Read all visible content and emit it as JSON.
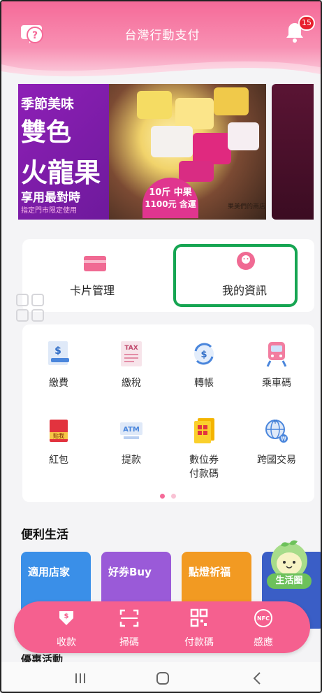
{
  "header": {
    "title": "台灣行動支付",
    "notification_count": "15"
  },
  "banner": {
    "headline_1": "季節美味",
    "headline_2": "雙色",
    "headline_3": "火龍果",
    "headline_4": "享用最對時",
    "sub": "指定門市限定使用",
    "price_1": "10斤 中果",
    "price_2": "1100元 含運",
    "shop": "果美們的商店"
  },
  "quick": {
    "card_label": "卡片管理",
    "info_label": "我的資訊"
  },
  "services": [
    {
      "label": "繳費",
      "icon": "bill-icon"
    },
    {
      "label": "繳稅",
      "icon": "tax-icon"
    },
    {
      "label": "轉帳",
      "icon": "transfer-icon"
    },
    {
      "label": "乘車碼",
      "icon": "train-icon"
    },
    {
      "label": "紅包",
      "icon": "red-envelope-icon"
    },
    {
      "label": "提款",
      "icon": "atm-icon"
    },
    {
      "label": "數位券\n付款碼",
      "icon": "coupon-icon"
    },
    {
      "label": "跨國交易",
      "icon": "globe-icon"
    }
  ],
  "section": {
    "convenience": "便利生活",
    "promotions": "優惠活動"
  },
  "promos": [
    {
      "label": "適用店家",
      "color": "#3a8fe8"
    },
    {
      "label": "好券Buy",
      "color": "#9a5ad8"
    },
    {
      "label": "點燈祈福",
      "color": "#f29a22"
    }
  ],
  "mascot": {
    "label": "生活圈"
  },
  "actions": [
    {
      "label": "收款",
      "icon": "receive-icon"
    },
    {
      "label": "掃碼",
      "icon": "scan-icon"
    },
    {
      "label": "付款碼",
      "icon": "qr-code-icon"
    },
    {
      "label": "感應",
      "icon": "nfc-icon"
    }
  ],
  "colors": {
    "accent": "#f5608f",
    "highlight": "#16a552"
  }
}
